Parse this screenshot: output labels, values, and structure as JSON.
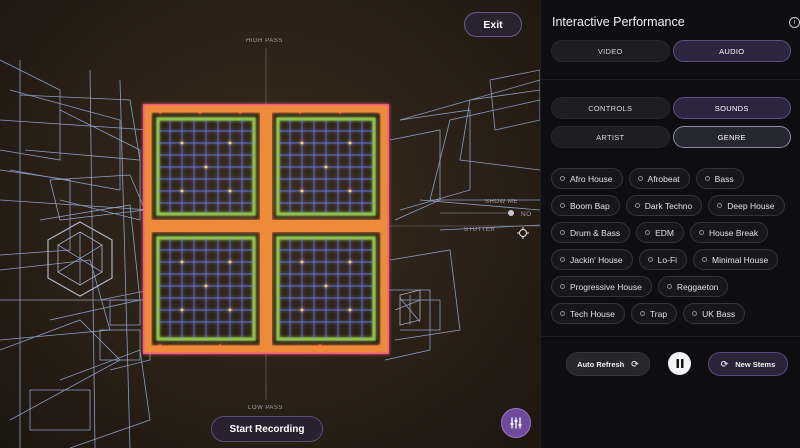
{
  "canvas": {
    "exit_label": "Exit",
    "axis_labels": {
      "top": "HIGH PASS",
      "bottom": "LOW PASS",
      "right_stutter": "STUTTER",
      "right_show": "SHOW ME",
      "right_no": "NO"
    },
    "start_recording_label": "Start Recording",
    "mixer_icon": "sliders-icon",
    "crosshair_icon": "crosshair-icon"
  },
  "panel": {
    "title": "Interactive Performance",
    "info_icon": "i",
    "mode_tabs": [
      {
        "label": "VIDEO",
        "active": false
      },
      {
        "label": "AUDIO",
        "active": true
      }
    ],
    "section_tabs": [
      {
        "label": "CONTROLS",
        "active": false
      },
      {
        "label": "SOUNDS",
        "active": true
      }
    ],
    "filter_tabs": [
      {
        "label": "ARTIST",
        "active": false
      },
      {
        "label": "GENRE",
        "active": true
      }
    ],
    "genres": [
      [
        "Afro House",
        "Afrobeat",
        "Bass"
      ],
      [
        "Boom Bap",
        "Dark Techno",
        "Deep House"
      ],
      [
        "Drum & Bass",
        "EDM",
        "House Break"
      ],
      [
        "Jackin' House",
        "Lo-Fi",
        "Minimal House"
      ],
      [
        "Progressive House",
        "Reggaeton"
      ],
      [
        "Tech House",
        "Trap",
        "UK Bass"
      ]
    ],
    "auto_refresh_label": "Auto Refresh",
    "new_stems_label": "New Stems"
  },
  "colors": {
    "accent_purple": "#5d4d86",
    "grid_orange": "#f08a3a",
    "grid_green": "#8cc04a",
    "wire_blue": "#8fb8ff"
  }
}
